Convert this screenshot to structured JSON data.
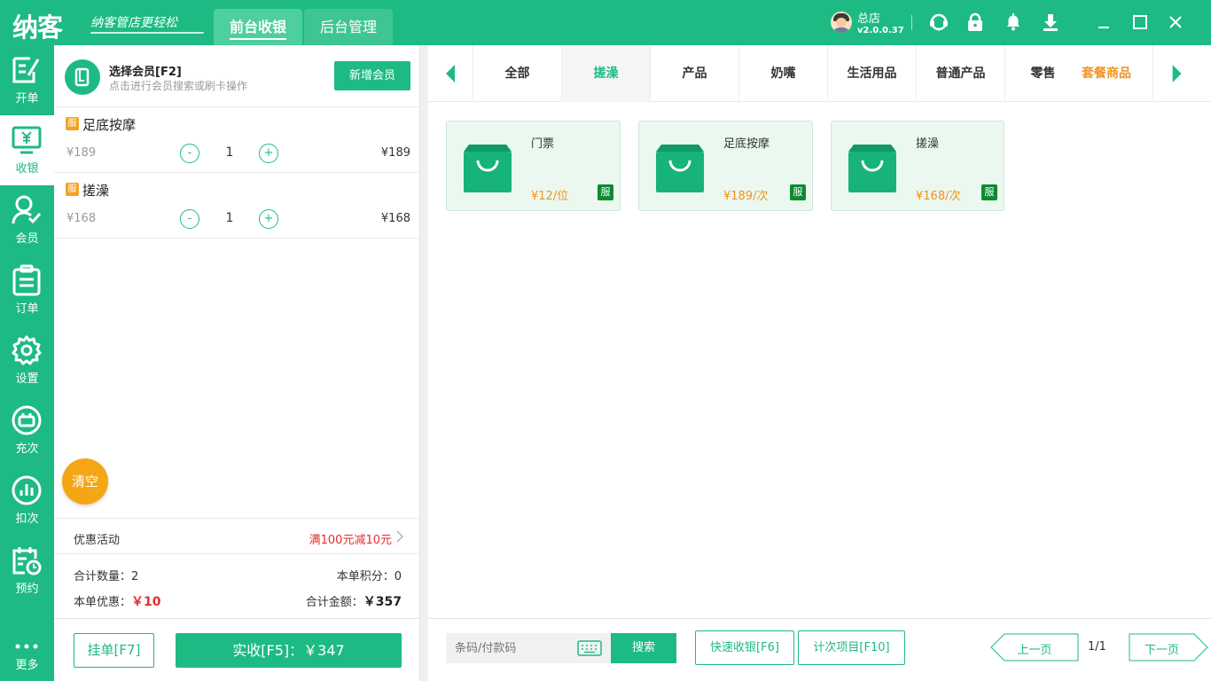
{
  "app": {
    "logo": "纳客",
    "slogan": "纳客管店更轻松",
    "tabs": [
      {
        "label": "前台收银"
      },
      {
        "label": "后台管理"
      }
    ],
    "user": {
      "name": "总店",
      "version": "v2.0.0.37"
    }
  },
  "sidebar": {
    "items": [
      {
        "label": "开单"
      },
      {
        "label": "收银"
      },
      {
        "label": "会员"
      },
      {
        "label": "订单"
      },
      {
        "label": "设置"
      },
      {
        "label": "充次"
      },
      {
        "label": "扣次"
      },
      {
        "label": "预约"
      },
      {
        "label": "更多"
      }
    ]
  },
  "member": {
    "title": "选择会员[F2]",
    "subtitle": "点击进行会员搜索或刷卡操作",
    "add_label": "新增会员"
  },
  "cart": {
    "items": [
      {
        "badge": "服",
        "name": "足底按摩",
        "price": "¥189",
        "minus": "-",
        "qty": "1",
        "plus": "+",
        "total": "¥189"
      },
      {
        "badge": "服",
        "name": "搓澡",
        "price": "¥168",
        "minus": "-",
        "qty": "1",
        "plus": "+",
        "total": "¥168"
      }
    ],
    "clear_label": "清空",
    "promo_label": "优惠活动",
    "promo_value": "满100元减10元",
    "count_label": "合计数量：",
    "count_value": "2",
    "points_label": "本单积分：",
    "points_value": "0",
    "discount_label": "本单优惠：",
    "discount_value": "￥10",
    "total_label": "合计金额：",
    "total_value": "￥357",
    "hang_label": "挂单[F7]",
    "pay_label": "实收[F5]：￥347"
  },
  "categories": {
    "tabs": [
      {
        "label": "全部"
      },
      {
        "label": "搓澡"
      },
      {
        "label": "产品"
      },
      {
        "label": "奶嘴"
      },
      {
        "label": "生活用品"
      },
      {
        "label": "普通产品"
      },
      {
        "label": "零售"
      },
      {
        "label": "套餐商品"
      }
    ]
  },
  "products": [
    {
      "name": "门票",
      "price": "¥12/位",
      "badge": "服"
    },
    {
      "name": "足底按摩",
      "price": "¥189/次",
      "badge": "服"
    },
    {
      "name": "搓澡",
      "price": "¥168/次",
      "badge": "服"
    }
  ],
  "footer": {
    "code_placeholder": "条码/付款码",
    "search_label": "搜索",
    "quick_label": "快速收银[F6]",
    "count_item_label": "计次项目[F10]",
    "prev_label": "上一页",
    "page_info": "1/1",
    "next_label": "下一页"
  },
  "colors": {
    "accent": "#1dbb83",
    "orange": "#f1941e",
    "red": "#e82c2c"
  }
}
